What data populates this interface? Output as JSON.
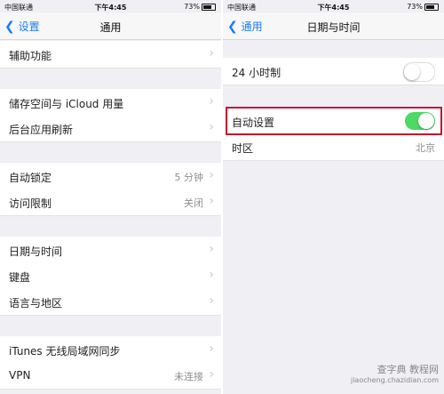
{
  "status": {
    "carrier": "中国联通",
    "time": "下午4:45",
    "battery": "73%"
  },
  "left": {
    "nav": {
      "back": "设置",
      "title": "通用"
    },
    "rows": [
      {
        "label": "辅助功能"
      },
      {
        "label": "储存空间与 iCloud 用量"
      },
      {
        "label": "后台应用刷新"
      },
      {
        "label": "自动锁定",
        "value": "5 分钟"
      },
      {
        "label": "访问限制",
        "value": "关闭"
      },
      {
        "label": "日期与时间"
      },
      {
        "label": "键盘"
      },
      {
        "label": "语言与地区"
      },
      {
        "label": "iTunes 无线局域网同步"
      },
      {
        "label": "VPN",
        "value": "未连接"
      }
    ]
  },
  "right": {
    "nav": {
      "back": "通用",
      "title": "日期与时间"
    },
    "rows": [
      {
        "label": "24 小时制",
        "toggle": false
      },
      {
        "label": "自动设置",
        "toggle": true
      },
      {
        "label": "时区",
        "value": "北京"
      }
    ]
  },
  "watermark": {
    "line1": "查字典 教程网",
    "line2": "jiaocheng.chazidian.com"
  },
  "colors": {
    "accent": "#1a7cf5",
    "toggle_on": "#4cd964",
    "highlight": "#c8102e"
  }
}
